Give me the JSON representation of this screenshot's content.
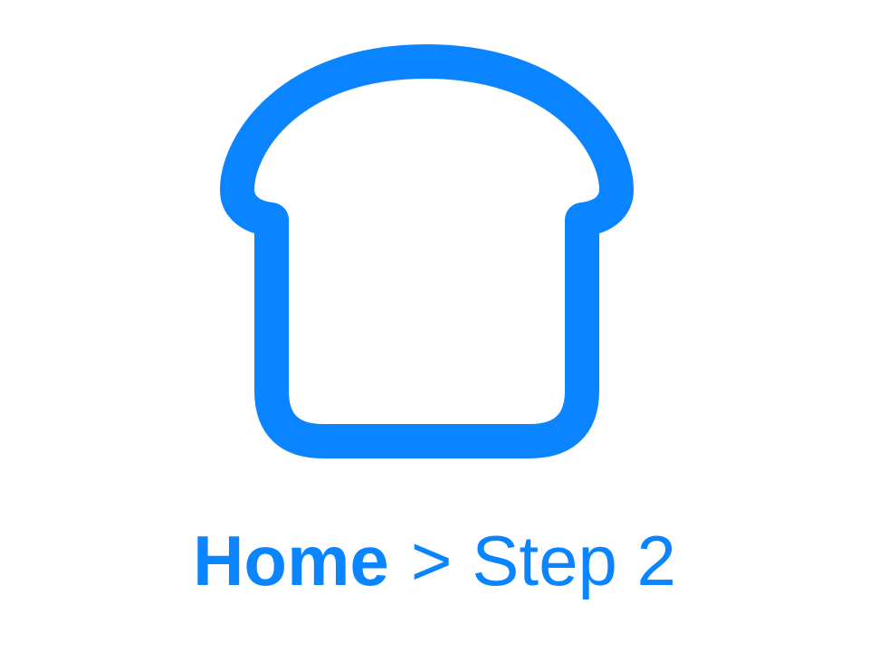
{
  "theme": {
    "accent": "#0A84FF",
    "background": "#FFFFFF"
  },
  "hero": {
    "icon": "bread-slice-icon"
  },
  "breadcrumb": {
    "home_label": "Home",
    "separator": ">",
    "current_label": "Step 2"
  }
}
